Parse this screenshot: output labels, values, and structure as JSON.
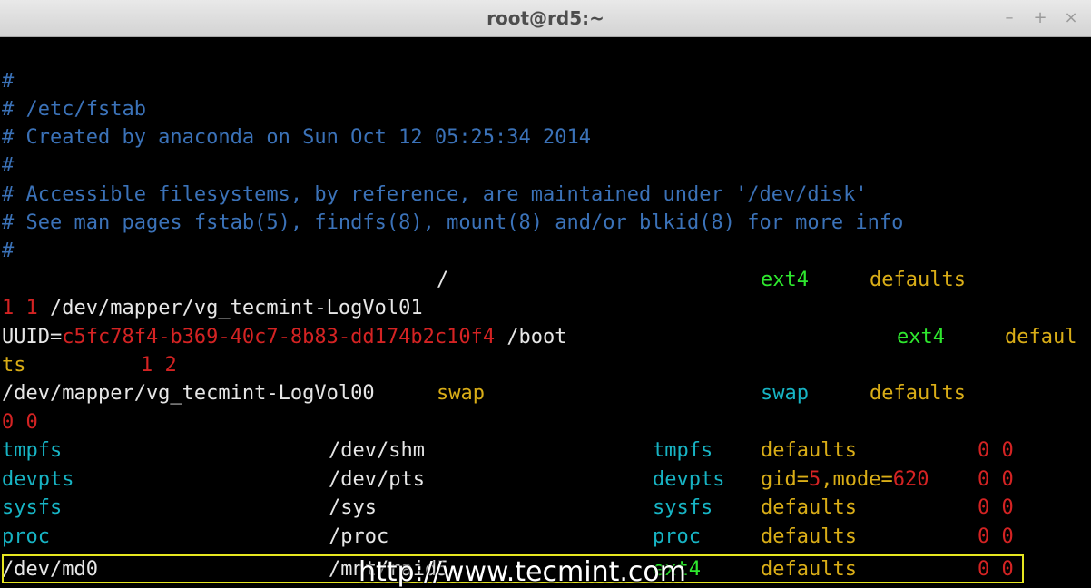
{
  "window": {
    "title": "root@rd5:~",
    "controls": {
      "minimize": "–",
      "maximize": "+",
      "close": "×"
    }
  },
  "terminal": {
    "comments": [
      "#",
      "# /etc/fstab",
      "# Created by anaconda on Sun Oct 12 05:25:34 2014",
      "#",
      "# Accessible filesystems, by reference, are maintained under '/dev/disk'",
      "# See man pages fstab(5), findfs(8), mount(8) and/or blkid(8) for more info",
      "#"
    ],
    "entry1": {
      "device": "/dev/mapper/vg_tecmint-LogVol01",
      "mount": "/",
      "type": "ext4",
      "options": "defaults",
      "dump_pass": "1 1"
    },
    "entry2": {
      "uuid_key": "UUID=",
      "uuid_val": "c5fc78f4-b369-40c7-8b83-dd174b2c10f4",
      "mount": "/boot",
      "type": "ext4",
      "options_a": "defaul",
      "options_b": "ts",
      "dump_pass": "1 2"
    },
    "entry3": {
      "device": "/dev/mapper/vg_tecmint-LogVol00",
      "mount": "swap",
      "type": "swap",
      "options": "defaults",
      "dump_pass": "0 0"
    },
    "entry4": {
      "device": "tmpfs",
      "mount": "/dev/shm",
      "type": "tmpfs",
      "options": "defaults",
      "dump_pass": "0 0"
    },
    "entry5": {
      "device": "devpts",
      "mount": "/dev/pts",
      "type": "devpts",
      "opt_gid_key": "gid=",
      "opt_gid_val": "5",
      "opt_mode_key": ",mode=",
      "opt_mode_val": "620",
      "dump_pass": "0 0"
    },
    "entry6": {
      "device": "sysfs",
      "mount": "/sys",
      "type": "sysfs",
      "options": "defaults",
      "dump_pass": "0 0"
    },
    "entry7": {
      "device": "proc",
      "mount": "/proc",
      "type": "proc",
      "options": "defaults",
      "dump_pass": "0 0"
    },
    "entry8": {
      "device": "/dev/md0",
      "mount": "/mnt/raid5",
      "type": "ext4",
      "options": "defaults",
      "dump_pass": "0 0"
    }
  },
  "watermark": "http://www.tecmint.com",
  "colors": {
    "comment": "#3b72b8",
    "path": "#e6e6e6",
    "fstype": "#2ee82e",
    "option": "#d9ad17",
    "number": "#d42323",
    "column": "#17b4c4",
    "highlight_box": "#e6e620"
  }
}
